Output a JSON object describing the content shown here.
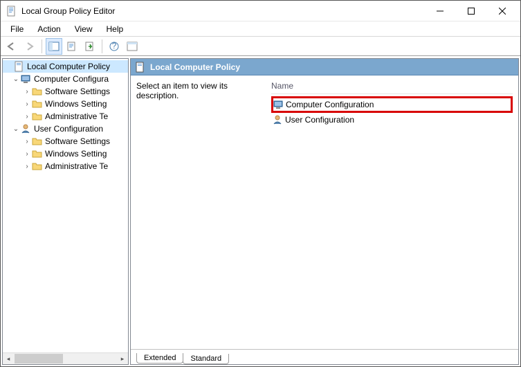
{
  "window": {
    "title": "Local Group Policy Editor"
  },
  "menu": {
    "file": "File",
    "action": "Action",
    "view": "View",
    "help": "Help"
  },
  "tree": {
    "root": "Local Computer Policy",
    "cc": "Computer Configura",
    "cc_sw": "Software Settings",
    "cc_ws": "Windows Setting",
    "cc_at": "Administrative Te",
    "uc": "User Configuration",
    "uc_sw": "Software Settings",
    "uc_ws": "Windows Setting",
    "uc_at": "Administrative Te"
  },
  "main": {
    "header": "Local Computer Policy",
    "description": "Select an item to view its description.",
    "col_name": "Name",
    "item_cc": "Computer Configuration",
    "item_uc": "User Configuration"
  },
  "tabs": {
    "extended": "Extended",
    "standard": "Standard"
  }
}
